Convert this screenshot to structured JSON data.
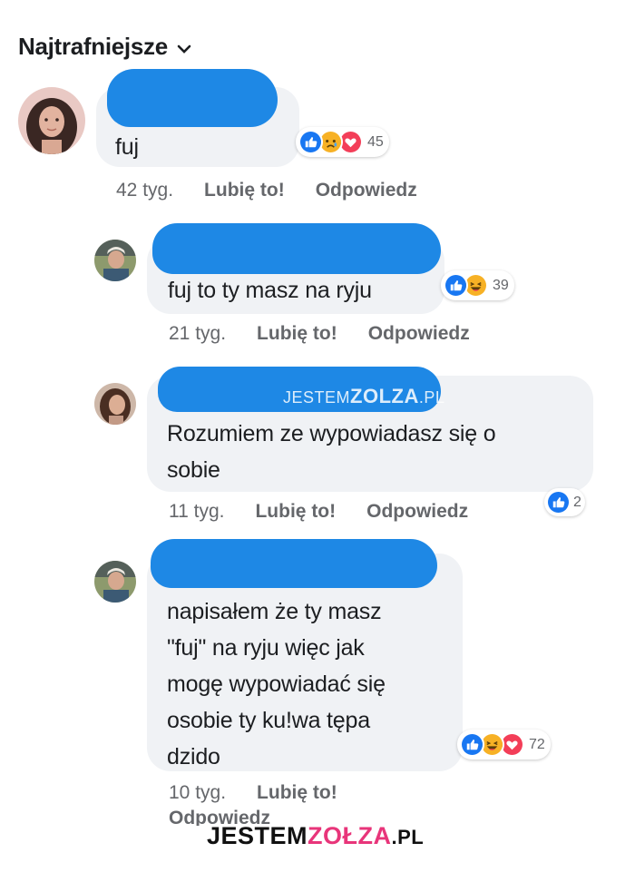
{
  "sort": {
    "label": "Najtrafniejsze"
  },
  "comments": [
    {
      "text": "fuj",
      "reaction_count": "45",
      "reactions": [
        "like-icon",
        "sad-icon",
        "love-icon"
      ],
      "time": "42 tyg.",
      "like_label": "Lubię to!",
      "reply_label": "Odpowiedz"
    },
    {
      "text": "fuj to ty masz na ryju",
      "reaction_count": "39",
      "reactions": [
        "like-icon",
        "haha-icon"
      ],
      "time": "21 tyg.",
      "like_label": "Lubię to!",
      "reply_label": "Odpowiedz"
    },
    {
      "text_lines": [
        "Rozumiem ze wypowiadasz się o",
        "sobie"
      ],
      "reaction_count": "2",
      "reactions": [
        "like-icon"
      ],
      "time": "11 tyg.",
      "like_label": "Lubię to!",
      "reply_label": "Odpowiedz"
    },
    {
      "text_lines": [
        "napisałem że ty masz",
        "\"fuj\" na ryju więc jak",
        "mogę wypowiadać się",
        "osobie ty ku!wa tępa",
        "dzido"
      ],
      "reaction_count": "72",
      "reactions": [
        "like-icon",
        "haha-icon",
        "love-icon"
      ],
      "time": "10 tyg.",
      "like_label": "Lubię to!",
      "reply_label": "Odpowiedz"
    }
  ],
  "watermarks": {
    "mid_prefix": "JESTEM",
    "mid_main": "ZOLZA",
    "mid_suffix": ".PL",
    "brand_prefix": "JESTEM",
    "brand_main": "ZOŁZA",
    "brand_suffix": ".PL"
  },
  "colors": {
    "blot": "#1e88e5",
    "bubble": "#f0f2f5",
    "like": "#1877f2",
    "love": "#f33e58",
    "haha": "#f7b125",
    "brand_accent": "#e8357a"
  }
}
